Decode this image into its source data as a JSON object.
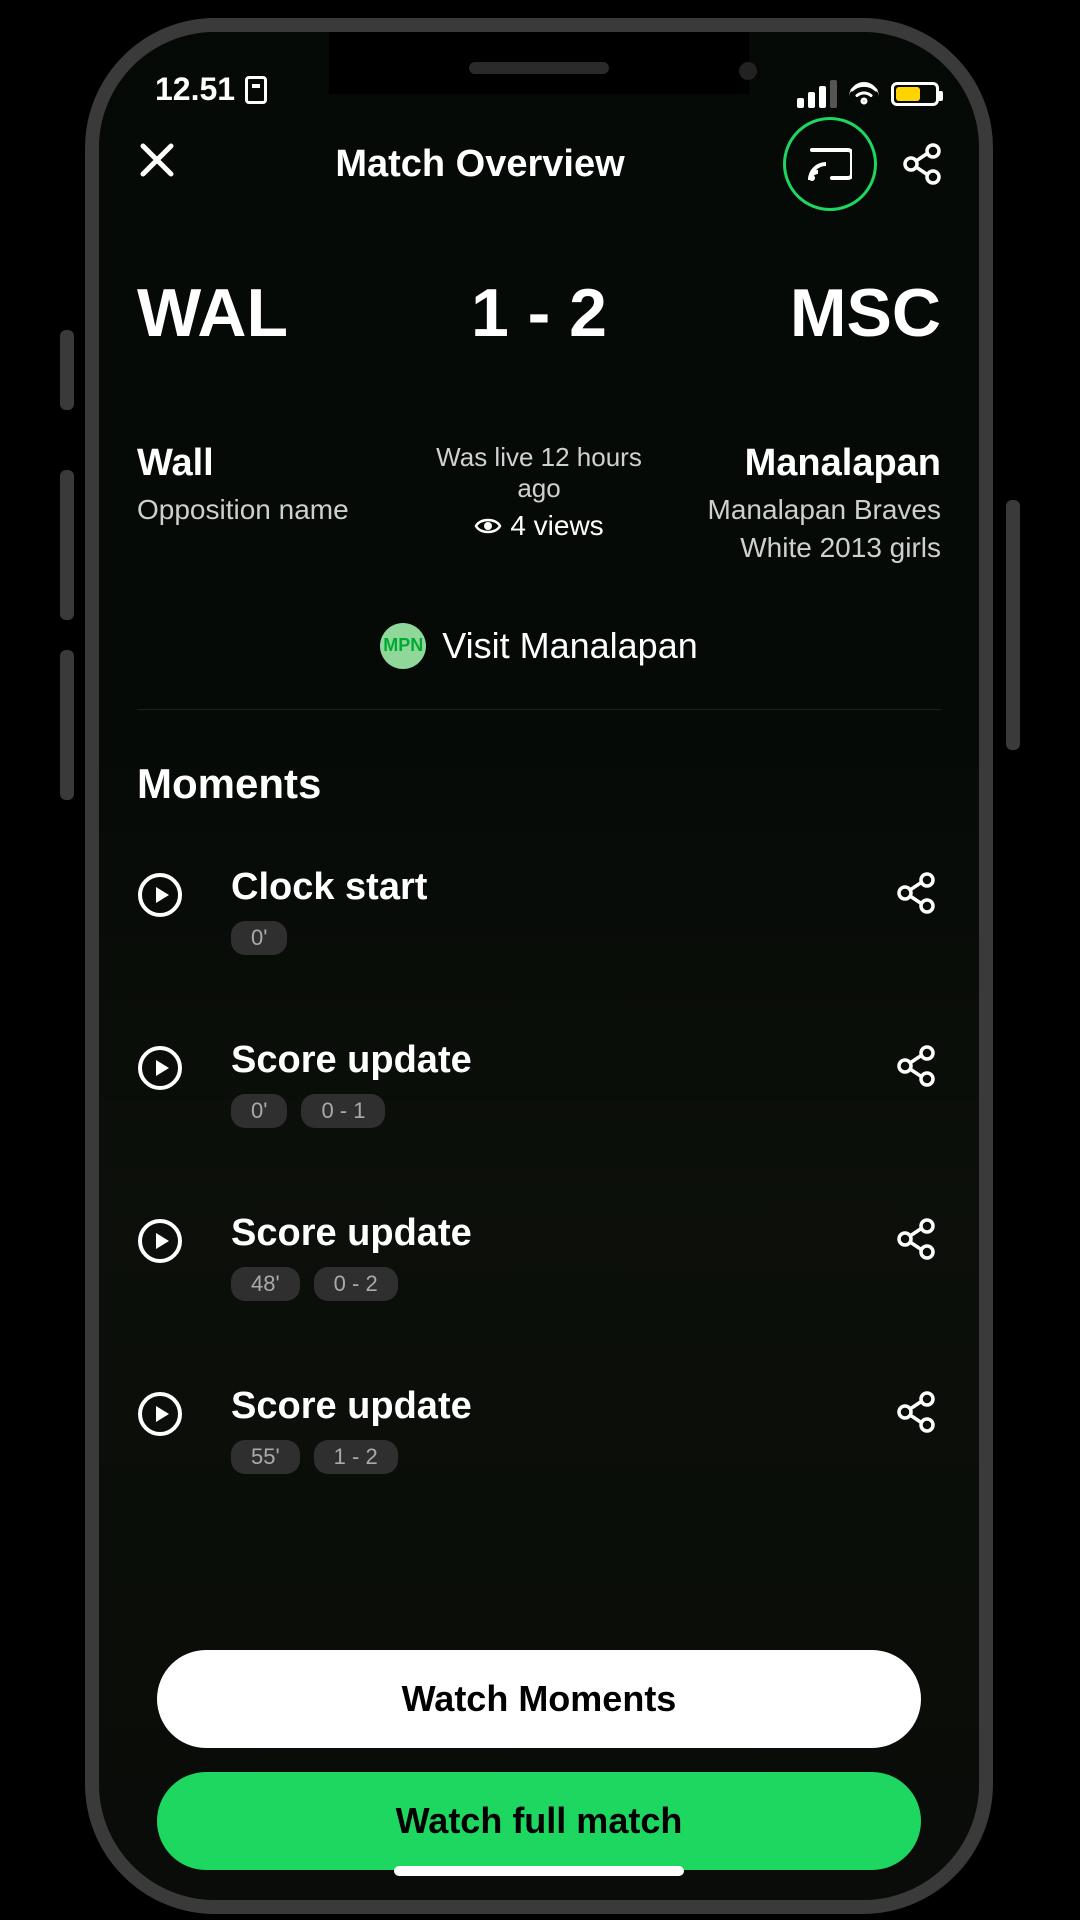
{
  "status": {
    "time": "12.51"
  },
  "header": {
    "title": "Match Overview"
  },
  "match": {
    "away_abbr": "WAL",
    "home_abbr": "MSC",
    "score": "1 - 2",
    "away_name": "Wall",
    "away_sub": "Opposition name",
    "home_name": "Manalapan",
    "home_sub": "Manalapan Braves White 2013 girls",
    "live_status": "Was live 12 hours ago",
    "views": "4 views",
    "visit_label": "Visit Manalapan",
    "badge_text": "MPN"
  },
  "moments": {
    "heading": "Moments",
    "items": [
      {
        "title": "Clock start",
        "time": "0'",
        "score": ""
      },
      {
        "title": "Score update",
        "time": "0'",
        "score": "0 - 1"
      },
      {
        "title": "Score update",
        "time": "48'",
        "score": "0 - 2"
      },
      {
        "title": "Score update",
        "time": "55'",
        "score": "1 - 2"
      }
    ]
  },
  "buttons": {
    "watch_moments": "Watch Moments",
    "watch_full": "Watch full match"
  }
}
